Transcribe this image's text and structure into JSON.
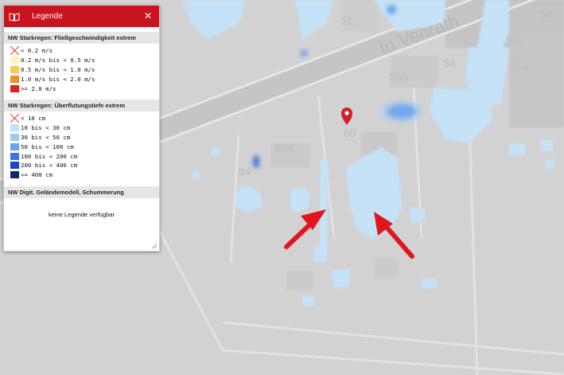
{
  "panel": {
    "title": "Legende",
    "sections": [
      {
        "heading": "NW Starkregen: Fließgeschwindigkeit extrem",
        "items": [
          {
            "label": "< 0.2 m/s",
            "color": "",
            "crossed": true
          },
          {
            "label": "0.2 m/s bis < 0.5 m/s",
            "color": "#fdf4b8"
          },
          {
            "label": "0.5 m/s bis < 1.0 m/s",
            "color": "#f7c85a"
          },
          {
            "label": "1.0 m/s bis < 2.0 m/s",
            "color": "#f08a2c"
          },
          {
            "label": ">= 2.0 m/s",
            "color": "#e0201b"
          }
        ]
      },
      {
        "heading": "NW Starkregen: Überflutungstiefe extrem",
        "items": [
          {
            "label": "< 10 cm",
            "color": "",
            "crossed": true
          },
          {
            "label": "10 bis < 30 cm",
            "color": "#c5e2f7"
          },
          {
            "label": "30 bis < 50 cm",
            "color": "#9ccaf2"
          },
          {
            "label": "50 bis < 100 cm",
            "color": "#6aa4ee"
          },
          {
            "label": "100 bis < 200 cm",
            "color": "#3c73e6"
          },
          {
            "label": "200 bis < 400 cm",
            "color": "#1c45c2"
          },
          {
            "label": ">= 400 cm",
            "color": "#0d2a6c"
          }
        ]
      },
      {
        "heading": "NW Digit. Geländemodell, Schummerung",
        "note": "keine Legende verfügbar"
      }
    ]
  },
  "map": {
    "street_name": "In Venrath",
    "house_numbers": [
      "51",
      "54",
      "56",
      "56a",
      "58",
      "58b",
      "60",
      "60a",
      "64"
    ],
    "marker_color": "#d3202a",
    "arrow_color": "#e1161c",
    "water_light": "#c5e2f7",
    "water_mid": "#9ccaf2",
    "water_deep": "#3c73e6"
  }
}
